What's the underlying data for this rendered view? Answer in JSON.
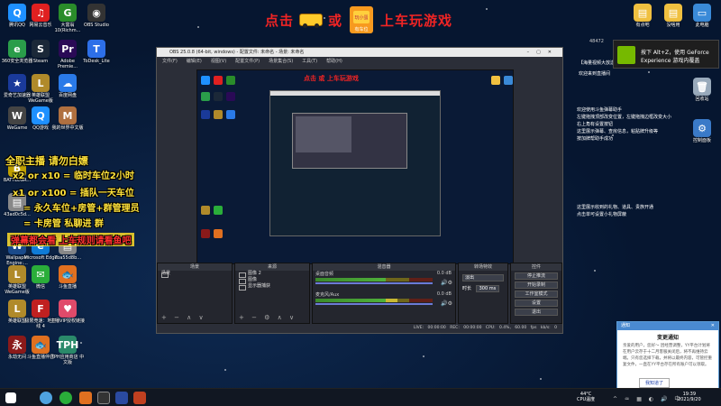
{
  "banner": {
    "part1": "点击",
    "part2": "或",
    "part3": "上车玩游戏",
    "badge_label": "有车位",
    "badge_box": "玩小蛋"
  },
  "desktop_left": [
    {
      "label": "腾讯QQ",
      "color": "#1e90ff",
      "glyph": "Q"
    },
    {
      "label": "网易云音乐",
      "color": "#e02020",
      "glyph": "♫"
    },
    {
      "label": "大富翁10(Richm...",
      "color": "#2a8c2a",
      "glyph": "G"
    },
    {
      "label": "OBS Studio",
      "color": "#333",
      "glyph": "◉"
    },
    {
      "label": "360安全浏览器",
      "color": "#2a9d4a",
      "glyph": "e"
    },
    {
      "label": "Steam",
      "color": "#1b2838",
      "glyph": "S"
    },
    {
      "label": "Adobe Premie...",
      "color": "#2a0a56",
      "glyph": "Pr"
    },
    {
      "label": "ToDesk_Lite",
      "color": "#2d6fe8",
      "glyph": "T"
    },
    {
      "label": "爱奇艺加速器",
      "color": "#1a3a9a",
      "glyph": "★"
    },
    {
      "label": "英雄联盟WeGame版",
      "color": "#b08a2a",
      "glyph": "L"
    },
    {
      "label": "百度网盘",
      "color": "#2a7ae8",
      "glyph": "☁"
    },
    {
      "label": "WeGame",
      "color": "#444",
      "glyph": "W"
    },
    {
      "label": "QQ游戏",
      "color": "#1e90ff",
      "glyph": "Q"
    },
    {
      "label": "我的世界中文版",
      "color": "#b07040",
      "glyph": "M"
    },
    {
      "label": "BATTLEGR...",
      "color": "#c0a000",
      "glyph": "B"
    },
    {
      "label": "43ad0c5d...",
      "color": "#888",
      "glyph": "▤"
    },
    {
      "label": "Wallpaper Engine:...",
      "color": "#1a4a8a",
      "glyph": "W"
    },
    {
      "label": "Microsoft Edge",
      "color": "#0f7bd6",
      "glyph": "e"
    },
    {
      "label": "7ba55d8b...",
      "color": "#888",
      "glyph": "▤"
    },
    {
      "label": "英雄联盟WeGame版",
      "color": "#b08a2a",
      "glyph": "L"
    },
    {
      "label": "微信",
      "color": "#2aae3a",
      "glyph": "✉"
    },
    {
      "label": "斗鱼直播",
      "color": "#e07020",
      "glyph": "🐟"
    },
    {
      "label": "英雄联盟",
      "color": "#b08a2a",
      "glyph": "L"
    },
    {
      "label": "极限竞速：地平线 4",
      "color": "#c02020",
      "glyph": "F"
    },
    {
      "label": "主播VIP授权链接",
      "color": "#e04a6a",
      "glyph": "♥"
    },
    {
      "label": "永劫无间",
      "color": "#8a1a1a",
      "glyph": "永"
    },
    {
      "label": "斗鱼直播伴侣",
      "color": "#e07020",
      "glyph": "🐟"
    },
    {
      "label": "TPH应用商店 中文版",
      "color": "#2a8a6a",
      "glyph": "TPH"
    }
  ],
  "desktop_right": [
    {
      "label": "有点吧",
      "color": "#f0c040",
      "glyph": "▤"
    },
    {
      "label": "没啥用",
      "color": "#f0c040",
      "glyph": "▤"
    },
    {
      "label": "此电脑",
      "color": "#3a8ad8",
      "glyph": "▭"
    },
    {
      "label": "回收站",
      "color": "#9ab",
      "glyph": "🗑"
    },
    {
      "label": "控制面板",
      "color": "#3a7ac8",
      "glyph": "⚙"
    }
  ],
  "obs": {
    "title": "OBS 25.0.8 (64-bit, windows) - 配置文件: 未命名 - 场景: 未命名",
    "menu": [
      "文件(F)",
      "编辑(E)",
      "视图(V)",
      "配置文件(P)",
      "场景集合(S)",
      "工具(T)",
      "帮助(H)"
    ],
    "docks": {
      "scenes": {
        "header": "场景",
        "items": [
          "场景"
        ]
      },
      "sources": {
        "header": "来源",
        "items": [
          "图像 2",
          "图像",
          "显示器捕获"
        ]
      },
      "mixer": {
        "header": "混音器",
        "channels": [
          {
            "name": "桌面音频",
            "db": "0.0 dB",
            "level": 0.6
          },
          {
            "name": "麦克风/Aux",
            "db": "0.0 dB",
            "level": 0.7
          }
        ]
      },
      "transitions": {
        "header": "转场特效",
        "type": "淡出",
        "duration_label": "时长",
        "duration": "300 ms"
      },
      "controls": {
        "header": "控件",
        "buttons": [
          "停止推流",
          "开始录制",
          "工作室模式",
          "设置",
          "退出"
        ]
      }
    },
    "status": {
      "live": "LIVE: 00:00:00",
      "rec": "REC: 00:00:00",
      "cpu": "CPU: 0.4%, 60.00 fps",
      "kbps": "kb/s: 0"
    }
  },
  "overlay": {
    "line0": "全职主播 请勿白嫖",
    "line1": "x2 or    x10 = 临时车位2小时",
    "line2": "x1 or    x100 = 插队一天车位",
    "line3": "= 永久车位+房管+群管理员",
    "line4": "= 卡房管 私聊进    群",
    "line5": "弹幕都会看 上车规则请看鱼吧",
    "preview_banner": "点击    或    上车玩游戏"
  },
  "right_panel": {
    "top_count": "48472",
    "item1": "【海量视频大放送中】",
    "item2": "欢迎来到直播间",
    "help_title": "欢迎使用斗鱼弹幕助手",
    "help_lines": [
      "左键拖拽顶部改变位置，左键拖拽边框改变大小",
      "右上角有设置按钮",
      "这里展示弹幕、查房信息，粘贴牌升级等",
      "按加牌帮助手成功"
    ],
    "gift_lines": [
      "这里展示收到的礼物、道具、贵族开通",
      "点击单可设置小礼物屏蔽"
    ]
  },
  "nvidia": {
    "line1": "按下 Alt+Z，使用 GeForce",
    "line2": "Experience 游戏内覆盖"
  },
  "notification": {
    "header": "通知",
    "title": "变更通知",
    "body": "亲爱的用户，您好～ 因经营调整，YY平台计划将在用户云存于十二月客服关闭后，将不再维持云端。只有您选择下载，并将以最终内容，可管控重复文件，一直在YY平台存在所有账户可以领取。",
    "button": "我知道了"
  },
  "tray": {
    "temp": "44°C",
    "temp_label": "CPU温度",
    "time": "19:39",
    "date": "2021/9/20"
  }
}
